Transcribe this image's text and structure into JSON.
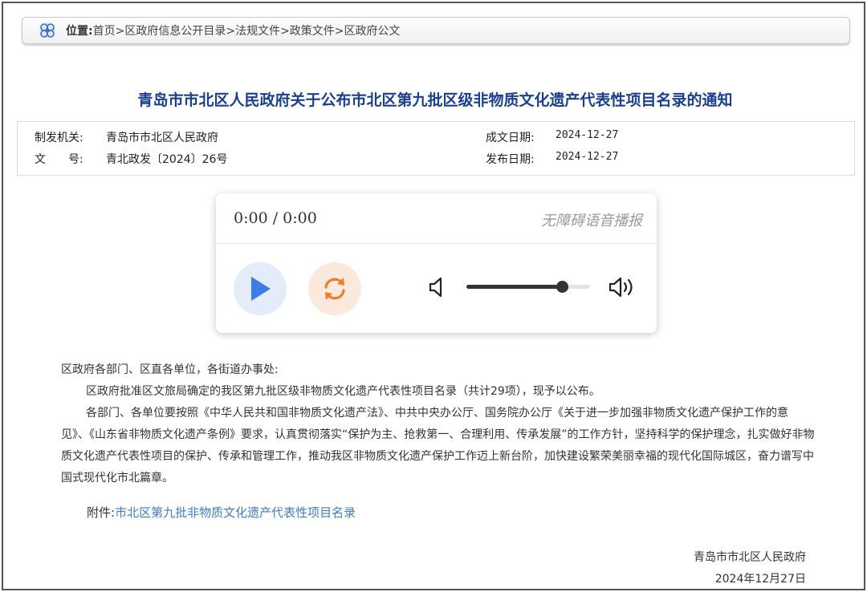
{
  "breadcrumb": {
    "icon": "logo-icon",
    "label": "位置:",
    "path": "首页>区政府信息公开目录>法规文件>政策文件>区政府公文"
  },
  "title": "青岛市市北区人民政府关于公布市北区第九批区级非物质文化遗产代表性项目名录的通知",
  "meta": {
    "issuer_label": "制发机关:",
    "issuer": "青岛市市北区人民政府",
    "docno_label": "文　　号:",
    "docno": "青北政发〔2024〕26号",
    "written_label": "成文日期:",
    "written_date": "2024-12-27",
    "publish_label": "发布日期:",
    "publish_date": "2024-12-27"
  },
  "player": {
    "time": "0:00 / 0:00",
    "label": "无障碍语音播报",
    "volume": 0.77,
    "accent_play": "#3e7be6",
    "accent_replay": "#f07d2c"
  },
  "body": {
    "salutation": "区政府各部门、区直各单位，各街道办事处:",
    "para1": "区政府批准区文旅局确定的我区第九批区级非物质文化遗产代表性项目名录（共计29项），现予以公布。",
    "para2": "各部门、各单位要按照《中华人民共和国非物质文化遗产法》、中共中央办公厅、国务院办公厅《关于进一步加强非物质文化遗产保护工作的意见》、《山东省非物质文化遗产条例》要求，认真贯彻落实“保护为主、抢救第一、合理利用、传承发展”的工作方针，坚持科学的保护理念，扎实做好非物质文化遗产代表性项目的保护、传承和管理工作，推动我区非物质文化遗产保护工作迈上新台阶，加快建设繁荣美丽幸福的现代化国际城区，奋力谱写中国式现代化市北篇章。"
  },
  "attachment": {
    "label": "附件:",
    "link": "市北区第九批非物质文化遗产代表性项目名录"
  },
  "signature": {
    "org": "青岛市市北区人民政府",
    "date": "2024年12月27日"
  }
}
